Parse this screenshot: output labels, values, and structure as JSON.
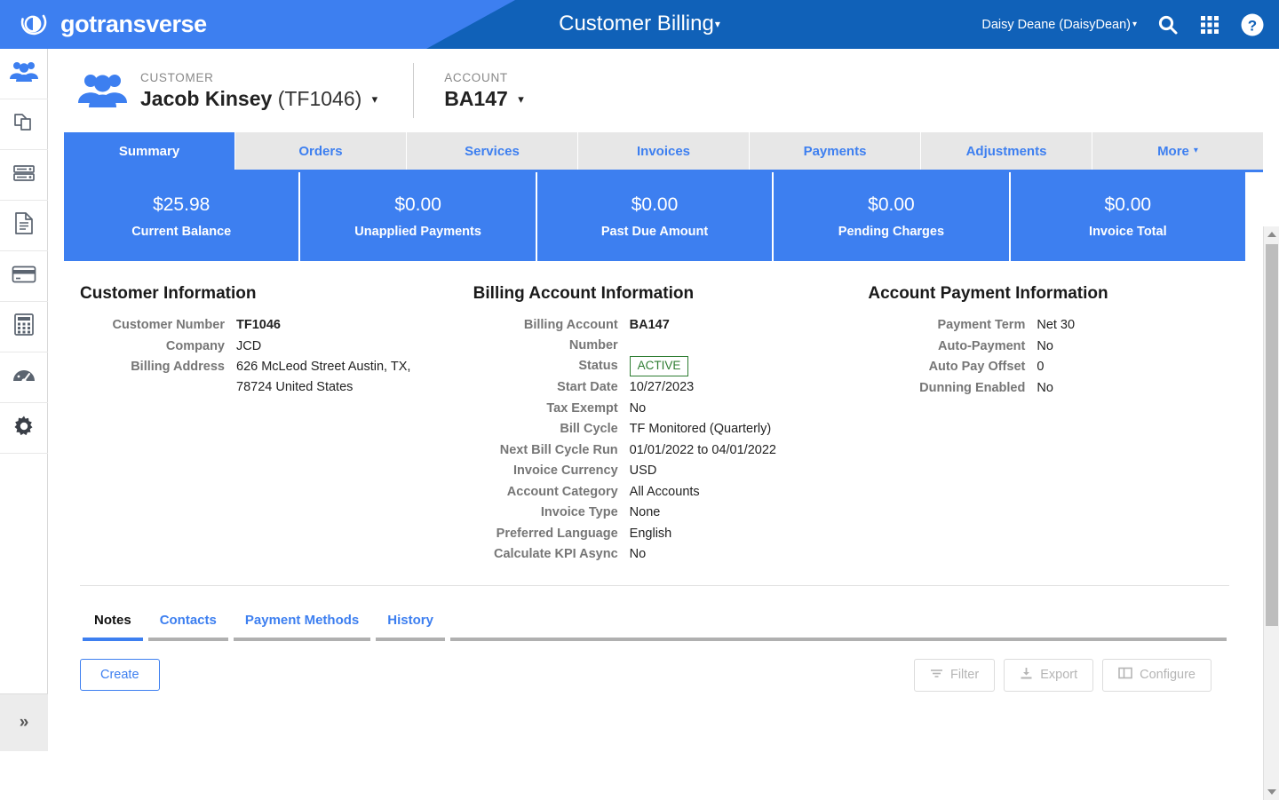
{
  "brand": {
    "name": "gotransverse",
    "logo_icon": "gotransverse-circle-logo",
    "primary": "#3d7ff0",
    "header_bg": "#1061b8"
  },
  "header": {
    "app_title": "Customer Billing",
    "app_title_caret": "▾",
    "user": "Daisy Deane (DaisyDean)",
    "user_caret": "▾",
    "icons": [
      {
        "name": "search-icon"
      },
      {
        "name": "apps-grid-icon"
      },
      {
        "name": "help-icon"
      }
    ]
  },
  "sidebar": {
    "items": [
      {
        "name": "sidebar-item-customers",
        "icon": "people-icon"
      },
      {
        "name": "sidebar-item-products",
        "icon": "copy-pages-icon"
      },
      {
        "name": "sidebar-item-servers",
        "icon": "server-stack-icon"
      },
      {
        "name": "sidebar-item-documents",
        "icon": "document-icon"
      },
      {
        "name": "sidebar-item-payments",
        "icon": "credit-card-icon"
      },
      {
        "name": "sidebar-item-calculator",
        "icon": "calculator-icon"
      },
      {
        "name": "sidebar-item-dashboard",
        "icon": "gauge-icon"
      },
      {
        "name": "sidebar-item-settings",
        "icon": "gear-icon"
      }
    ],
    "expand_icon": "double-chevron-right-icon"
  },
  "context": {
    "customer_label": "CUSTOMER",
    "customer_name": "Jacob Kinsey",
    "customer_number": "(TF1046)",
    "account_label": "ACCOUNT",
    "account_value": "BA147",
    "caret": "▾"
  },
  "tabs": [
    {
      "label": "Summary",
      "active": true
    },
    {
      "label": "Orders",
      "active": false
    },
    {
      "label": "Services",
      "active": false
    },
    {
      "label": "Invoices",
      "active": false
    },
    {
      "label": "Payments",
      "active": false
    },
    {
      "label": "Adjustments",
      "active": false
    },
    {
      "label": "More",
      "active": false,
      "caret": "▾"
    }
  ],
  "kpis": [
    {
      "amount": "$25.98",
      "label": "Current Balance"
    },
    {
      "amount": "$0.00",
      "label": "Unapplied Payments"
    },
    {
      "amount": "$0.00",
      "label": "Past Due Amount"
    },
    {
      "amount": "$0.00",
      "label": "Pending Charges"
    },
    {
      "amount": "$0.00",
      "label": "Invoice Total"
    }
  ],
  "customer_information": {
    "title": "Customer Information",
    "rows": [
      {
        "label": "Customer Number",
        "value": "TF1046",
        "bold": true
      },
      {
        "label": "Company",
        "value": "JCD"
      },
      {
        "label": "Billing Address",
        "value": "626 McLeod Street Austin, TX, 78724 United States"
      }
    ]
  },
  "billing_account_information": {
    "title": "Billing Account Information",
    "rows": [
      {
        "label": "Billing Account Number",
        "value": "BA147",
        "bold": true
      },
      {
        "label": "Status",
        "value": "ACTIVE",
        "badge": true
      },
      {
        "label": "Start Date",
        "value": "10/27/2023"
      },
      {
        "label": "Tax Exempt",
        "value": "No"
      },
      {
        "label": "Bill Cycle",
        "value": "TF Monitored (Quarterly)"
      },
      {
        "label": "Next Bill Cycle Run",
        "value": "01/01/2022 to 04/01/2022"
      },
      {
        "label": "Invoice Currency",
        "value": "USD"
      },
      {
        "label": "Account Category",
        "value": "All Accounts"
      },
      {
        "label": "Invoice Type",
        "value": "None"
      },
      {
        "label": "Preferred Language",
        "value": "English"
      },
      {
        "label": "Calculate KPI Async",
        "value": "No"
      }
    ]
  },
  "account_payment_information": {
    "title": "Account Payment Information",
    "rows": [
      {
        "label": "Payment Term",
        "value": "Net 30"
      },
      {
        "label": "Auto-Payment",
        "value": "No"
      },
      {
        "label": "Auto Pay Offset",
        "value": "0"
      },
      {
        "label": "Dunning Enabled",
        "value": "No"
      }
    ]
  },
  "subtabs": [
    {
      "label": "Notes",
      "active": true
    },
    {
      "label": "Contacts",
      "active": false
    },
    {
      "label": "Payment Methods",
      "active": false
    },
    {
      "label": "History",
      "active": false
    }
  ],
  "toolbar": {
    "create_label": "Create",
    "filter_label": "Filter",
    "export_label": "Export",
    "configure_label": "Configure"
  }
}
